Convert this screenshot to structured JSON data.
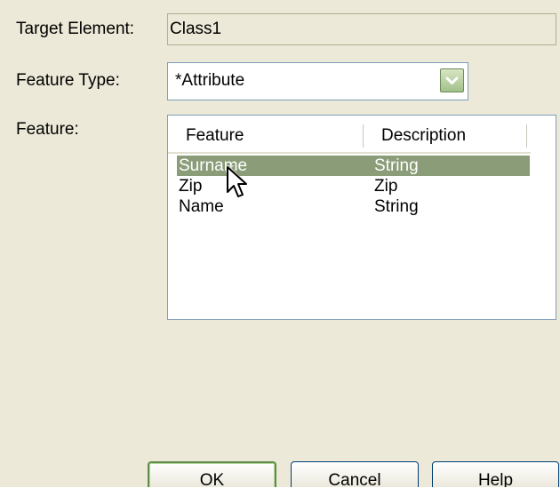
{
  "form": {
    "target_element_label": "Target Element:",
    "target_element_value": "Class1",
    "feature_type_label": "Feature Type:",
    "feature_type_value": "*Attribute",
    "feature_label": "Feature:"
  },
  "list": {
    "columns": [
      "Feature",
      "Description"
    ],
    "rows": [
      {
        "feature": "Surname",
        "description": "String",
        "selected": true
      },
      {
        "feature": "Zip",
        "description": "Zip",
        "selected": false
      },
      {
        "feature": "Name",
        "description": "String",
        "selected": false
      }
    ]
  },
  "buttons": {
    "ok": "OK",
    "cancel": "Cancel",
    "help": "Help"
  },
  "colors": {
    "dialog_bg": "#ece9d8",
    "selection_bg": "#8a9c78",
    "default_button_border": "#5f8e48",
    "field_border": "#7f9db9"
  },
  "icons": {
    "combo_arrow": "chevron-down-icon",
    "cursor": "mouse-pointer-icon"
  }
}
